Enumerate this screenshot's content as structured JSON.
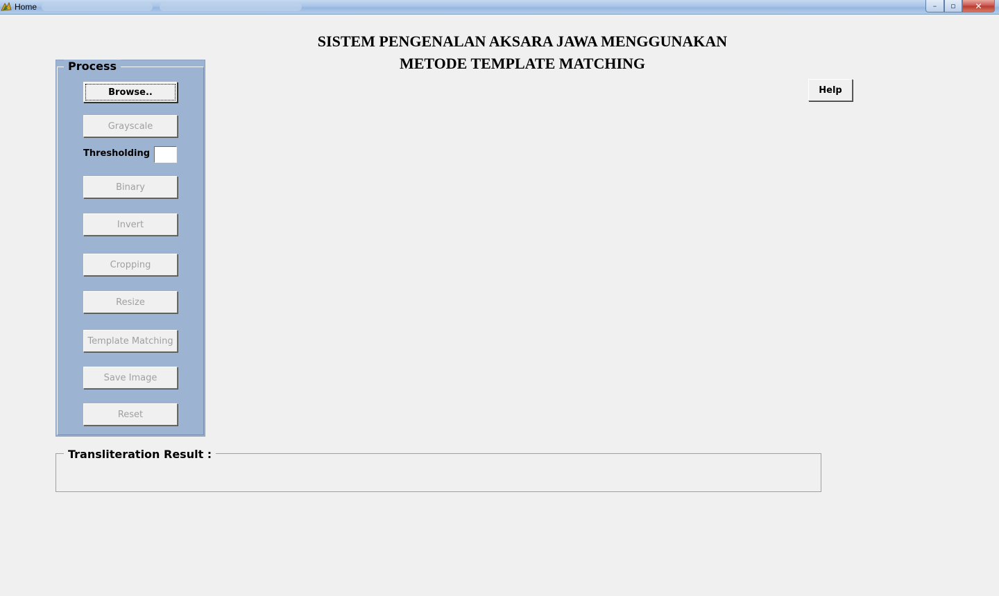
{
  "window": {
    "title": "Home",
    "controls": {
      "minimize": "–",
      "maximize": "▫",
      "close": "✕"
    }
  },
  "heading": {
    "line1": "SISTEM PENGENALAN AKSARA JAWA MENGGUNAKAN",
    "line2": "METODE TEMPLATE MATCHING"
  },
  "help_label": "Help",
  "process": {
    "title": "Process",
    "browse": "Browse..",
    "grayscale": "Grayscale",
    "threshold_label": "Thresholding :",
    "threshold_value": "",
    "binary": "Binary",
    "invert": "Invert",
    "cropping": "Cropping",
    "resize": "Resize",
    "template_matching": "Template Matching",
    "save_image": "Save Image",
    "reset": "Reset"
  },
  "result": {
    "title": "Transliteration Result :",
    "value": ""
  },
  "colors": {
    "panel_bg": "#9cb3d2",
    "window_bg": "#f0f0f0",
    "disabled_text": "#a0a0a0"
  }
}
